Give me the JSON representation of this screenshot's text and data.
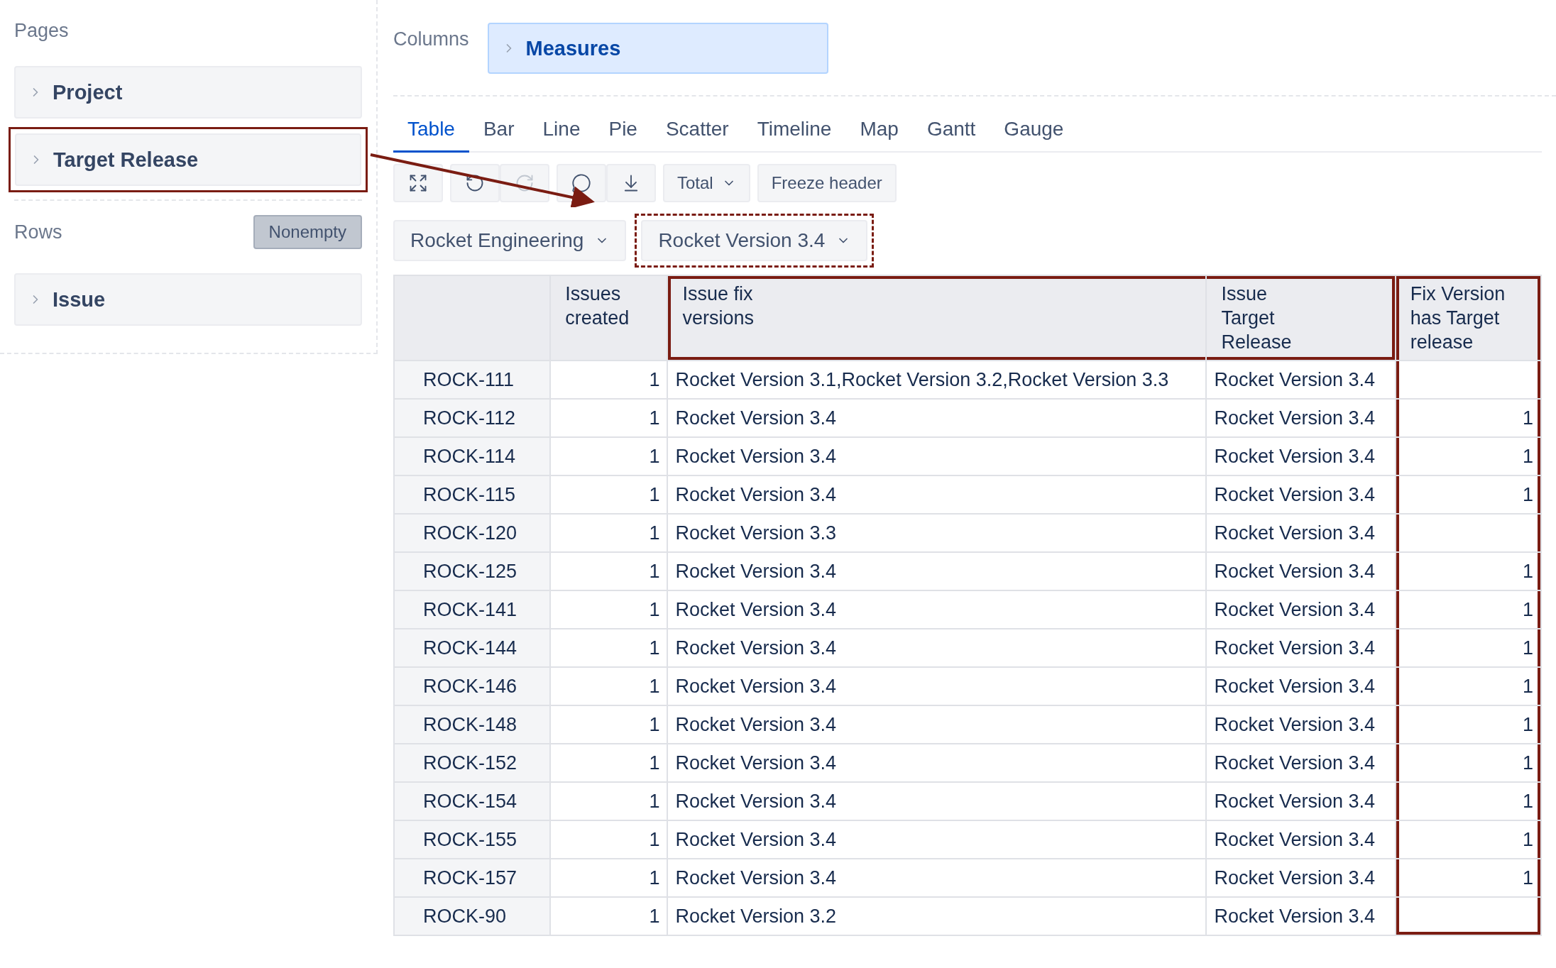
{
  "pages": {
    "title": "Pages",
    "items": [
      {
        "label": "Project",
        "highlighted": false
      },
      {
        "label": "Target Release",
        "highlighted": true
      }
    ]
  },
  "rows": {
    "title": "Rows",
    "nonempty_button": "Nonempty",
    "items": [
      {
        "label": "Issue",
        "highlighted": false
      }
    ]
  },
  "columns": {
    "title": "Columns",
    "items": [
      {
        "label": "Measures"
      }
    ]
  },
  "tabs": [
    {
      "label": "Table",
      "selected": true
    },
    {
      "label": "Bar",
      "selected": false
    },
    {
      "label": "Line",
      "selected": false
    },
    {
      "label": "Pie",
      "selected": false
    },
    {
      "label": "Scatter",
      "selected": false
    },
    {
      "label": "Timeline",
      "selected": false
    },
    {
      "label": "Map",
      "selected": false
    },
    {
      "label": "Gantt",
      "selected": false
    },
    {
      "label": "Gauge",
      "selected": false
    }
  ],
  "toolbar": [
    {
      "kind": "icon",
      "disabled": false
    },
    {
      "kind": "icon",
      "disabled": false
    },
    {
      "kind": "icon",
      "disabled": true
    },
    {
      "kind": "icon",
      "disabled": false
    },
    {
      "kind": "icon",
      "disabled": false
    },
    {
      "kind": "dropdown",
      "label": "Total"
    },
    {
      "kind": "button",
      "label": "Freeze header"
    }
  ],
  "filters": [
    {
      "label": "Rocket Engineering",
      "highlighted": false
    },
    {
      "label": "Rocket Version 3.4",
      "highlighted": true
    }
  ],
  "table": {
    "columns": [
      {
        "header_outlined": false,
        "column_outlined": false
      },
      {
        "label": "Issues\ncreated",
        "header_outlined": false,
        "column_outlined": false
      },
      {
        "label": "Issue fix\nversions",
        "header_outlined": true,
        "column_outlined": false
      },
      {
        "label": "Issue\nTarget\nRelease",
        "header_outlined": true,
        "column_outlined": false
      },
      {
        "label": "Fix Version\nhas Target\nrelease",
        "header_outlined": false,
        "column_outlined": true
      }
    ],
    "rows": [
      [
        "ROCK-111",
        "1",
        "Rocket Version 3.1,Rocket Version 3.2,Rocket Version 3.3",
        "Rocket Version 3.4",
        ""
      ],
      [
        "ROCK-112",
        "1",
        "Rocket Version 3.4",
        "Rocket Version 3.4",
        "1"
      ],
      [
        "ROCK-114",
        "1",
        "Rocket Version 3.4",
        "Rocket Version 3.4",
        "1"
      ],
      [
        "ROCK-115",
        "1",
        "Rocket Version 3.4",
        "Rocket Version 3.4",
        "1"
      ],
      [
        "ROCK-120",
        "1",
        "Rocket Version 3.3",
        "Rocket Version 3.4",
        ""
      ],
      [
        "ROCK-125",
        "1",
        "Rocket Version 3.4",
        "Rocket Version 3.4",
        "1"
      ],
      [
        "ROCK-141",
        "1",
        "Rocket Version 3.4",
        "Rocket Version 3.4",
        "1"
      ],
      [
        "ROCK-144",
        "1",
        "Rocket Version 3.4",
        "Rocket Version 3.4",
        "1"
      ],
      [
        "ROCK-146",
        "1",
        "Rocket Version 3.4",
        "Rocket Version 3.4",
        "1"
      ],
      [
        "ROCK-148",
        "1",
        "Rocket Version 3.4",
        "Rocket Version 3.4",
        "1"
      ],
      [
        "ROCK-152",
        "1",
        "Rocket Version 3.4",
        "Rocket Version 3.4",
        "1"
      ],
      [
        "ROCK-154",
        "1",
        "Rocket Version 3.4",
        "Rocket Version 3.4",
        "1"
      ],
      [
        "ROCK-155",
        "1",
        "Rocket Version 3.4",
        "Rocket Version 3.4",
        "1"
      ],
      [
        "ROCK-157",
        "1",
        "Rocket Version 3.4",
        "Rocket Version 3.4",
        "1"
      ],
      [
        "ROCK-90",
        "1",
        "Rocket Version 3.2",
        "Rocket Version 3.4",
        ""
      ]
    ]
  }
}
